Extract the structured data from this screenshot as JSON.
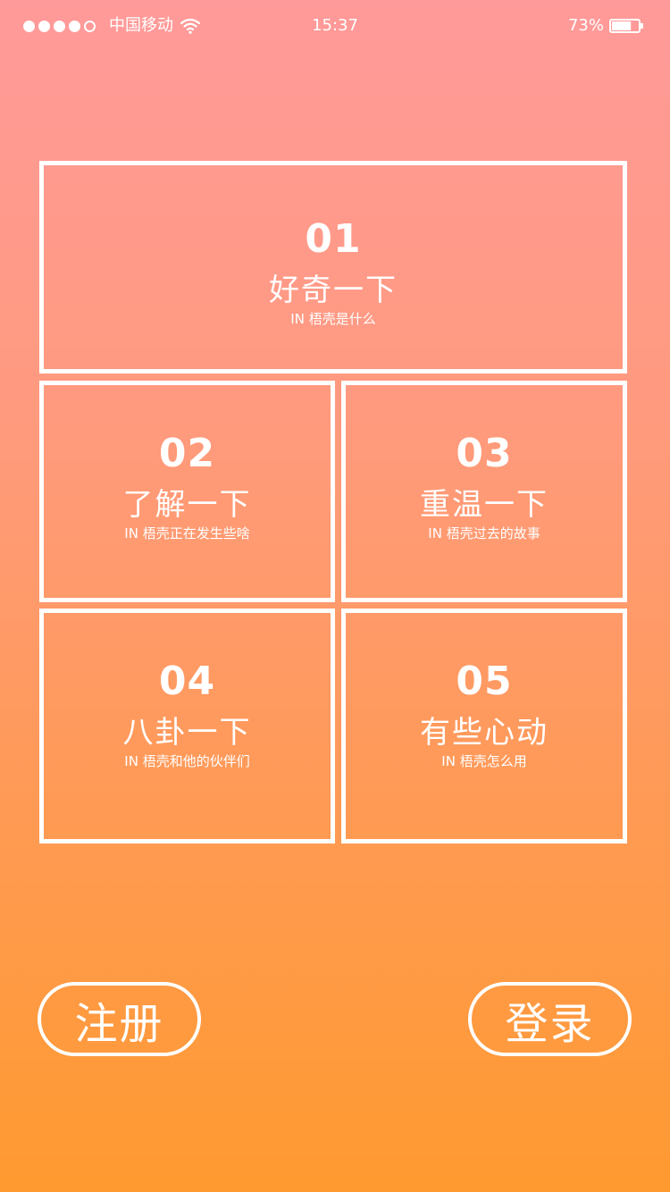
{
  "status_bar": {
    "carrier": "中国移动",
    "time": "15:37",
    "battery": "73%",
    "battery_level": 0.73
  },
  "cards": [
    {
      "number": "01",
      "title": "好奇一下",
      "subtitle": "IN 梧壳是什么"
    },
    {
      "number": "02",
      "title": "了解一下",
      "subtitle": "IN 梧壳正在发生些啥"
    },
    {
      "number": "03",
      "title": "重温一下",
      "subtitle": "IN 梧壳过去的故事"
    },
    {
      "number": "04",
      "title": "八卦一下",
      "subtitle": "IN 梧壳和他的伙伴们"
    },
    {
      "number": "05",
      "title": "有些心动",
      "subtitle": "IN 梧壳怎么用"
    }
  ],
  "buttons": {
    "register": "注册",
    "login": "登录"
  },
  "colors": {
    "gradient_top": "#ff9a9a",
    "gradient_bottom": "#ff9a30",
    "foreground": "#ffffff"
  }
}
